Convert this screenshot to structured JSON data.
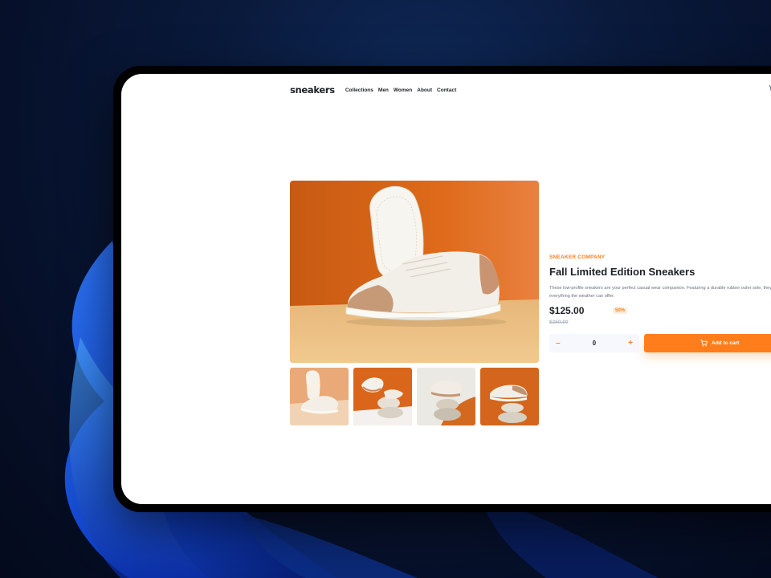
{
  "brand": {
    "logo": "sneakers",
    "accent": "#ff7e1b"
  },
  "nav": {
    "links": [
      "Collections",
      "Men",
      "Women",
      "About",
      "Contact"
    ]
  },
  "icons": {
    "cart": "cart-icon",
    "minus": "minus-icon",
    "plus": "plus-icon"
  },
  "product": {
    "company": "SNEAKER COMPANY",
    "title": "Fall Limited Edition Sneakers",
    "description": "These low-profile sneakers are your perfect casual wear companion. Featuring a durable rubber outer sole, they'll withstand everything the weather can offer.",
    "price": "$125.00",
    "discount": "50%",
    "old_price": "$250.00"
  },
  "quantity": {
    "minus_label": "–",
    "value": "0",
    "plus_label": "+"
  },
  "cart_button": {
    "label": "Add to cart"
  },
  "gallery": {
    "thumbnails": 4,
    "selected": 1
  }
}
